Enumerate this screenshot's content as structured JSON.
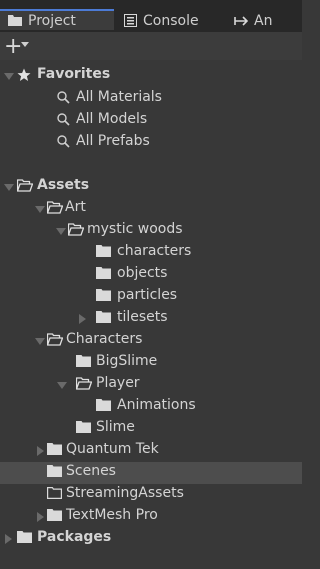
{
  "tabs": [
    {
      "label": "Project",
      "icon": "folder-icon"
    },
    {
      "label": "Console",
      "icon": "console-icon"
    },
    {
      "label": "An",
      "icon": "animation-icon"
    }
  ],
  "toolbar": {
    "add_label": "+"
  },
  "tree": {
    "favorites": "Favorites",
    "all_materials": "All Materials",
    "all_models": "All Models",
    "all_prefabs": "All Prefabs",
    "assets": "Assets",
    "art": "Art",
    "mystic_woods": "mystic woods",
    "characters_sub": "characters",
    "objects": "objects",
    "particles": "particles",
    "tilesets": "tilesets",
    "characters": "Characters",
    "bigslime": "BigSlime",
    "player": "Player",
    "animations": "Animations",
    "slime": "Slime",
    "quantum_tek": "Quantum Tek",
    "scenes": "Scenes",
    "streaming_assets": "StreamingAssets",
    "textmesh_pro": "TextMesh Pro",
    "packages": "Packages"
  },
  "colors": {
    "selected_row": "#4d4d4d",
    "active_tab_accent": "#4c7bd6"
  }
}
